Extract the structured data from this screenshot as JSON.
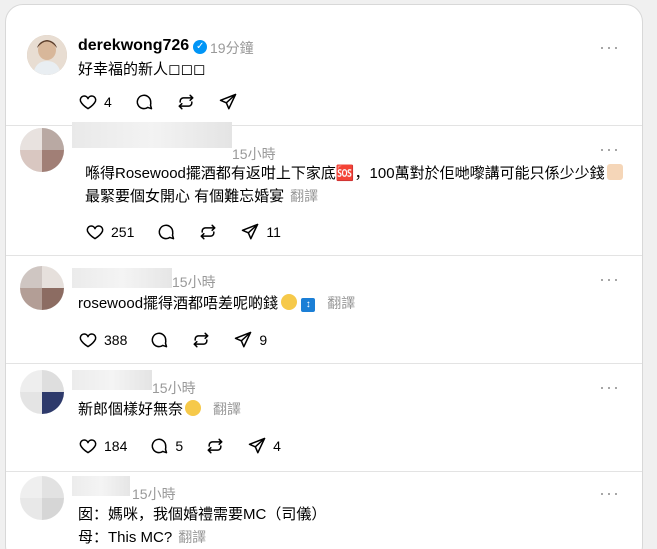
{
  "posts": [
    {
      "username": "derekwong726",
      "time": "19分鐘",
      "lines": [
        "好幸福的新人◻◻◻"
      ],
      "likes": "4",
      "comments": "",
      "reposts": "",
      "shares": ""
    },
    {
      "time": "15小時",
      "lines": [
        "喺得Rosewood擺酒都有返咁上下家底🆘，100萬對於佢哋嚟講可能只係少少錢"
      ],
      "line2": "最緊要個女開心 有個難忘婚宴",
      "translate": "翻譯",
      "likes": "251",
      "comments": "",
      "reposts": "",
      "shares": "11"
    },
    {
      "time": "15小時",
      "lines": [
        "rosewood擺得酒都唔差呢啲錢"
      ],
      "translate": "翻譯",
      "likes": "388",
      "comments": "",
      "reposts": "",
      "shares": "9"
    },
    {
      "time": "15小時",
      "lines": [
        "新郎個樣好無奈"
      ],
      "translate": "翻譯",
      "likes": "184",
      "comments": "5",
      "reposts": "",
      "shares": "4"
    },
    {
      "time": "15小時",
      "lines": [
        "囡：媽咪，我個婚禮需要MC（司儀）"
      ],
      "line2": "母：This MC?",
      "translate": "翻譯"
    }
  ],
  "icons": {
    "like": "heart-icon",
    "comment": "comment-icon",
    "repost": "repost-icon",
    "share": "share-icon",
    "more": "more-icon",
    "verified": "verified-badge-icon"
  },
  "colors": {
    "verified": "#0095f6",
    "secondary_text": "#999999",
    "divider": "#e3e3e3"
  }
}
